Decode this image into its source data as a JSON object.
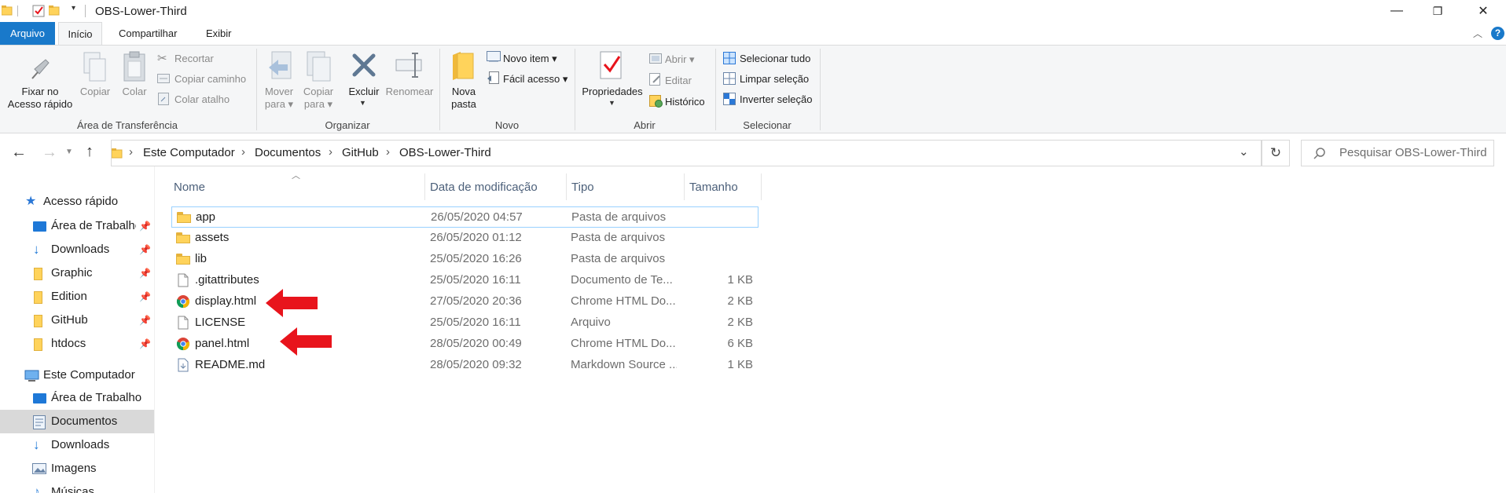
{
  "window": {
    "title": "OBS-Lower-Third",
    "controls": {
      "minimize": "—",
      "restore": "❐",
      "close": "✕"
    },
    "help_icon": "?"
  },
  "menu_tabs": [
    "Arquivo",
    "Início",
    "Compartilhar",
    "Exibir"
  ],
  "ribbon": {
    "pin": "Fixar no\nAcesso rápido",
    "copy": "Copiar",
    "paste": "Colar",
    "cut": "Recortar",
    "copy_path": "Copiar caminho",
    "paste_shortcut": "Colar atalho",
    "move_to": "Mover\npara ▾",
    "copy_to": "Copiar\npara ▾",
    "delete": "Excluir",
    "rename": "Renomear",
    "new_folder": "Nova\npasta",
    "new_item": "Novo item ▾",
    "easy_access": "Fácil acesso ▾",
    "properties": "Propriedades",
    "open": "Abrir ▾",
    "edit": "Editar",
    "history": "Histórico",
    "select_all": "Selecionar tudo",
    "select_none": "Limpar seleção",
    "invert_selection": "Inverter seleção",
    "groups": {
      "clipboard": "Área de Transferência",
      "organize": "Organizar",
      "new": "Novo",
      "open": "Abrir",
      "select": "Selecionar"
    }
  },
  "address": {
    "crumbs": [
      "Este Computador",
      "Documentos",
      "GitHub",
      "OBS-Lower-Third"
    ],
    "separator": "›",
    "search_placeholder": "Pesquisar OBS-Lower-Third"
  },
  "nav": {
    "quick_access": "Acesso rápido",
    "quick_items": [
      "Área de Trabalho",
      "Downloads",
      "Graphic",
      "Edition",
      "GitHub",
      "htdocs"
    ],
    "this_pc": "Este Computador",
    "pc_items": [
      "Área de Trabalho",
      "Documentos",
      "Downloads",
      "Imagens",
      "Músicas"
    ]
  },
  "columns": {
    "name": "Nome",
    "date": "Data de modificação",
    "type": "Tipo",
    "size": "Tamanho"
  },
  "files": [
    {
      "name": "app",
      "date": "26/05/2020 04:57",
      "type": "Pasta de arquivos",
      "size": "",
      "icon": "folder-icon"
    },
    {
      "name": "assets",
      "date": "26/05/2020 01:12",
      "type": "Pasta de arquivos",
      "size": "",
      "icon": "folder-icon"
    },
    {
      "name": "lib",
      "date": "25/05/2020 16:26",
      "type": "Pasta de arquivos",
      "size": "",
      "icon": "folder-icon"
    },
    {
      "name": ".gitattributes",
      "date": "25/05/2020 16:11",
      "type": "Documento de Te...",
      "size": "1 KB",
      "icon": "document-icon"
    },
    {
      "name": "display.html",
      "date": "27/05/2020 20:36",
      "type": "Chrome HTML Do...",
      "size": "2 KB",
      "icon": "chrome-icon"
    },
    {
      "name": "LICENSE",
      "date": "25/05/2020 16:11",
      "type": "Arquivo",
      "size": "2 KB",
      "icon": "document-icon"
    },
    {
      "name": "panel.html",
      "date": "28/05/2020 00:49",
      "type": "Chrome HTML Do...",
      "size": "6 KB",
      "icon": "chrome-icon"
    },
    {
      "name": "README.md",
      "date": "28/05/2020 09:32",
      "type": "Markdown Source ...",
      "size": "1 KB",
      "icon": "markdown-icon"
    }
  ],
  "colors": {
    "accent": "#1979ca",
    "arrow": "#e8141c",
    "selection": "#cce8ff"
  }
}
